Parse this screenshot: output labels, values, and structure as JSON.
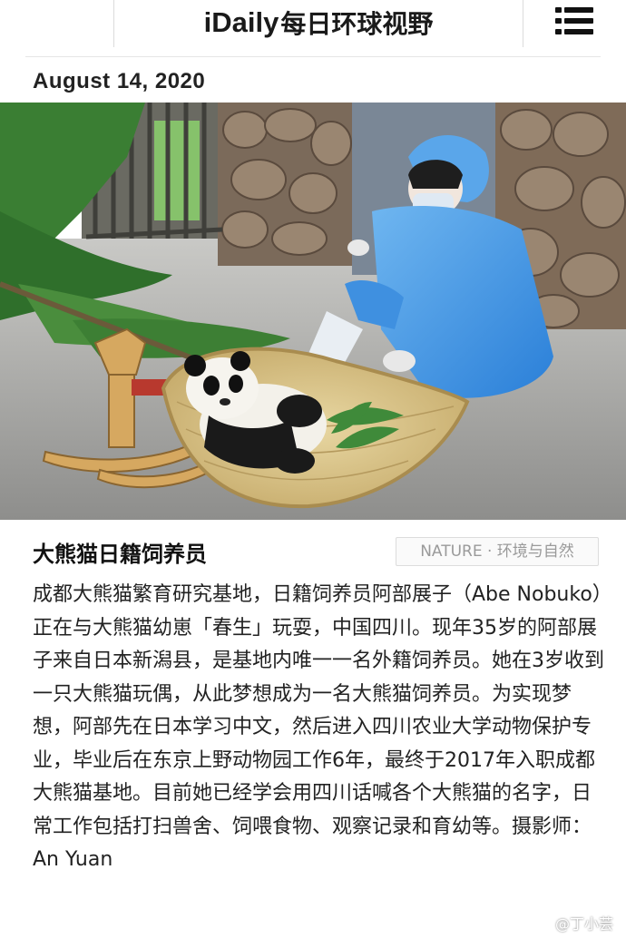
{
  "header": {
    "brand_latin": "iDaily",
    "brand_cjk": "每日环球视野",
    "menu_icon": "hamburger-menu-icon"
  },
  "article": {
    "date": "August 14, 2020",
    "photo_alt": "大熊猫日籍饲养员",
    "caption_title": "大熊猫日籍饲养员",
    "tag": "NATURE · 环境与自然",
    "body": "成都大熊猫繁育研究基地，日籍饲养员阿部展子（Abe Nobuko）正在与大熊猫幼崽「春生」玩耍，中国四川。现年35岁的阿部展子来自日本新潟县，是基地内唯一一名外籍饲养员。她在3岁收到一只大熊猫玩偶，从此梦想成为一名大熊猫饲养员。为实现梦想，阿部先在日本学习中文，然后进入四川农业大学动物保护专业，毕业后在东京上野动物园工作6年，最终于2017年入职成都大熊猫基地。目前她已经学会用四川话喊各个大熊猫的名字，日常工作包括打扫兽舍、饲喂食物、观察记录和育幼等。摄影师：An Yuan"
  },
  "watermark": {
    "text": "@丁小芸",
    "icon": "weibo-icon"
  },
  "colors": {
    "page_bg": "#ffffff",
    "text": "#222222",
    "tag_text": "#9a9a9a",
    "tag_border": "#dcdcdc"
  }
}
